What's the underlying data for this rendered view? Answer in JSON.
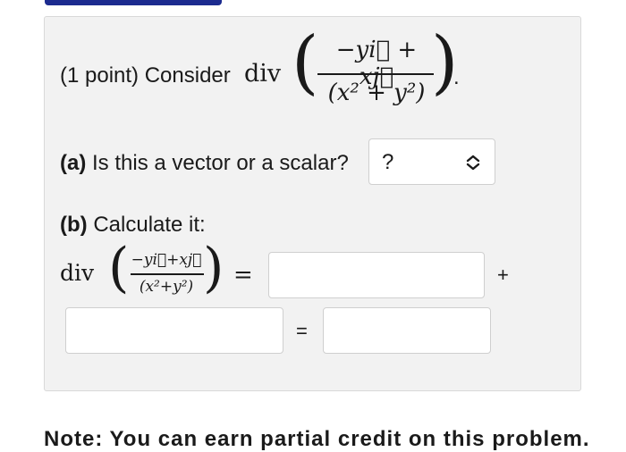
{
  "problem": {
    "points": "(1 point) Consider",
    "div": "div",
    "numerator": "−yi⃗ + xj⃗",
    "denominator": "(x² + y²)",
    "period": "."
  },
  "part_a": {
    "tag": "(a)",
    "question": "Is this a vector or a scalar?",
    "select_value": "?"
  },
  "part_b": {
    "tag": "(b)",
    "instruction": "Calculate it:",
    "div": "div",
    "numerator": "−yi⃗+xj⃗",
    "denominator": "(x²+y²)",
    "equals": "=",
    "plus": "+",
    "equals2": "="
  },
  "note": "Note: You can earn partial credit on this problem."
}
